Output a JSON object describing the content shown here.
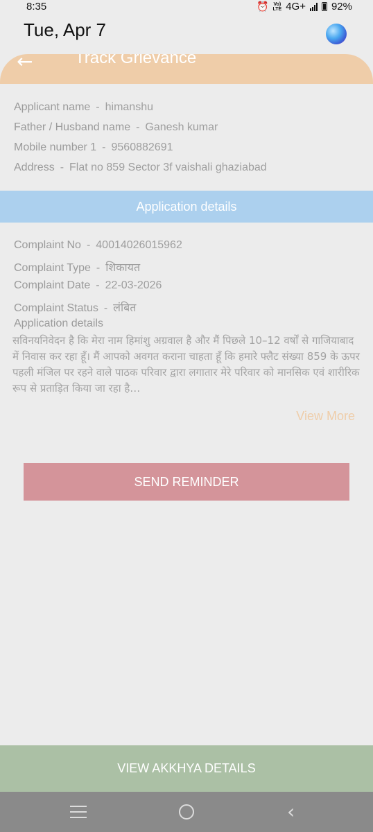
{
  "status_bar": {
    "time": "8:35",
    "alarm_icon": "alarm-icon",
    "volte_label": "Vo) LTE",
    "network": "4G+",
    "battery": "92%"
  },
  "date_line": "Tue, Apr 7",
  "header": {
    "title": "Track Grievance",
    "back_icon": "arrow-left-icon",
    "back_glyph": "←"
  },
  "applicant": {
    "rows": [
      {
        "label": "Applicant name",
        "value": "himanshu"
      },
      {
        "label": "Father / Husband name",
        "value": "Ganesh kumar"
      },
      {
        "label": "Mobile number 1",
        "value": "9560882691"
      },
      {
        "label": "Address",
        "value": "Flat no 859 Sector 3f vaishali ghaziabad"
      }
    ]
  },
  "section_title": "Application details",
  "complaint": {
    "rows": [
      {
        "label": "Complaint No",
        "value": "40014026015962"
      },
      {
        "label": "Complaint Type",
        "value": "शिकायत"
      },
      {
        "label": "Complaint Date",
        "value": "22-03-2026"
      },
      {
        "label": "Complaint Status",
        "value": "लंबित"
      }
    ],
    "separator": "-"
  },
  "details": {
    "heading": "Application details",
    "text": "सविनयनिवेदन है कि मेरा नाम हिमांशु अग्रवाल है और मैं पिछले 10–12 वर्षों से गाजियाबाद में निवास कर रहा हूँ। मैं आपको अवगत कराना चाहता हूँ कि हमारे फ्लैट संख्या 859 के ऊपर पहली मंजिल पर रहने वाले पाठक परिवार द्वारा लगातार मेरे परिवार को मानसिक एवं शारीरिक रूप से प्रताड़ित किया जा रहा है…",
    "view_more": "View More"
  },
  "buttons": {
    "send_reminder": "SEND REMINDER",
    "view_akkhya": "VIEW AKKHYA DETAILS"
  },
  "colors": {
    "header": "#efcda9",
    "section_bar": "#acd0ee",
    "send_button": "#d4949a",
    "akkhya_button": "#abc0a5",
    "pending_status": "#eab894"
  }
}
